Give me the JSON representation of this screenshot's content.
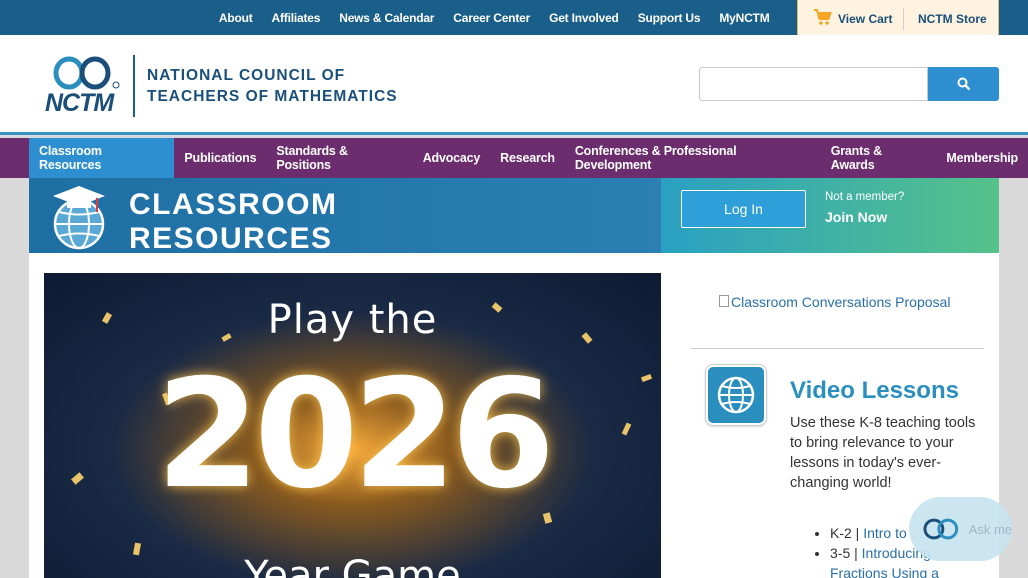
{
  "topbar": {
    "links": [
      "About",
      "Affiliates",
      "News & Calendar",
      "Career Center",
      "Get Involved",
      "Support Us",
      "MyNCTM"
    ],
    "cart_label": "View Cart",
    "store_label": "NCTM Store",
    "cart_color": "#f5a623"
  },
  "header": {
    "logo_acronym": "NCTM",
    "logo_line1": "NATIONAL COUNCIL OF",
    "logo_line2": "TEACHERS OF MATHEMATICS",
    "search_placeholder": ""
  },
  "nav": {
    "items": [
      {
        "label": "Classroom Resources",
        "active": true
      },
      {
        "label": "Publications",
        "active": false
      },
      {
        "label": "Standards & Positions",
        "active": false
      },
      {
        "label": "Advocacy",
        "active": false
      },
      {
        "label": "Research",
        "active": false
      },
      {
        "label": "Conferences & Professional Development",
        "active": false
      },
      {
        "label": "Grants & Awards",
        "active": false
      },
      {
        "label": "Membership",
        "active": false
      }
    ],
    "bg_color": "#6b2d6e",
    "active_color": "#2e8fd0"
  },
  "banner": {
    "title_line1": "CLASSROOM",
    "title_line2": "RESOURCES",
    "login_label": "Log In",
    "not_member": "Not a member?",
    "join_label": "Join Now"
  },
  "hero": {
    "line1": "Play the",
    "year": "2026",
    "line3": "Year Game"
  },
  "side": {
    "proposal_alt": "Classroom Conversations Proposal",
    "video_title": "Video Lessons",
    "video_desc": "Use these K-8 teaching tools to bring relevance to your lessons in today's ever-changing world!",
    "lessons": [
      {
        "grade": "K-2 | ",
        "link": "Intro to ..."
      },
      {
        "grade": "3-5 | ",
        "link": "Introducing Fractions Using a"
      }
    ]
  },
  "askme": {
    "label": "Ask me"
  }
}
